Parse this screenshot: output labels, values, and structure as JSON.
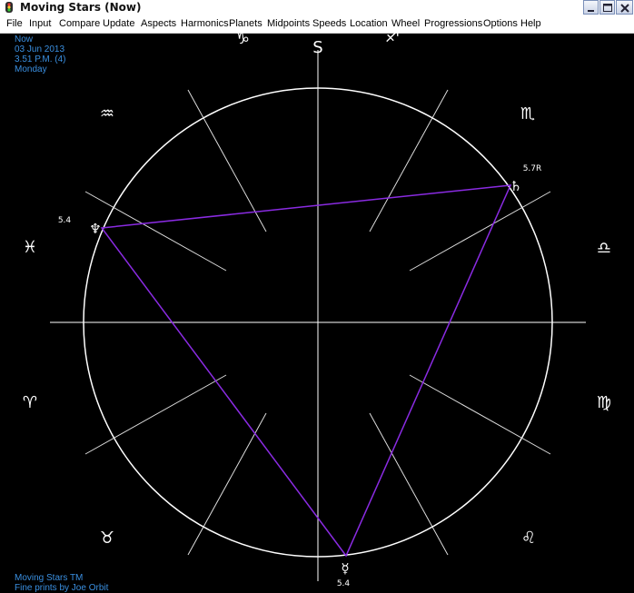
{
  "window": {
    "title": "Moving Stars (Now)"
  },
  "menu": [
    "File",
    "Input",
    "Compare",
    "Update",
    "Aspects",
    "Harmonics",
    "Planets",
    "Midpoints",
    "Speeds",
    "Location",
    "Wheel",
    "Progressions",
    "Options",
    "Help"
  ],
  "info": {
    "line1": "Now",
    "line2": "03 Jun 2013",
    "line3": "3.51 P.M. (4)",
    "line4": "Monday"
  },
  "footer": {
    "line1": "Moving Stars TM",
    "line2": "Fine prints by Joe Orbit"
  },
  "chart": {
    "south_label": "S",
    "signs": [
      {
        "name": "capricorn-sign",
        "glyph": "♑"
      },
      {
        "name": "sagittarius-sign",
        "glyph": "♐"
      },
      {
        "name": "aquarius-sign",
        "glyph": "♒"
      },
      {
        "name": "scorpio-sign",
        "glyph": "♏"
      },
      {
        "name": "pisces-sign",
        "glyph": "♓"
      },
      {
        "name": "libra-sign",
        "glyph": "♎"
      },
      {
        "name": "aries-sign",
        "glyph": "♈"
      },
      {
        "name": "virgo-sign",
        "glyph": "♍"
      },
      {
        "name": "taurus-sign",
        "glyph": "♉"
      },
      {
        "name": "leo-sign",
        "glyph": "♌"
      }
    ],
    "planets": [
      {
        "name": "neptune",
        "glyph": "♆",
        "value": "5.4"
      },
      {
        "name": "saturn",
        "glyph": "♄",
        "value": "5.7R"
      },
      {
        "name": "mercury",
        "glyph": "☿",
        "value": "5.4"
      }
    ],
    "colors": {
      "background": "#000000",
      "lines": "#ffffff",
      "aspect": "#8a2be2",
      "info_text": "#3a8fe0"
    }
  }
}
